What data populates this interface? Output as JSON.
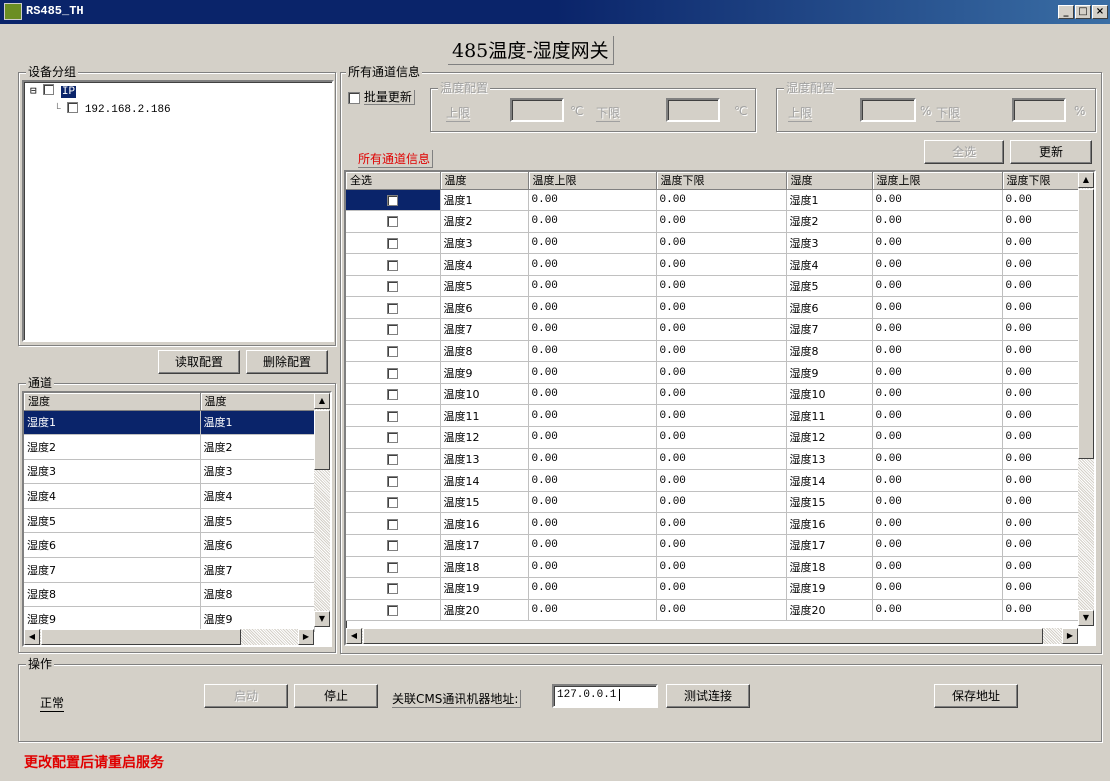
{
  "window": {
    "title": "RS485_TH",
    "min": "_",
    "max": "□",
    "close": "×"
  },
  "header": {
    "title": "485温度-湿度网关"
  },
  "device_group": {
    "label": "设备分组",
    "root": "IP",
    "root_toggle": "⊟",
    "child": "192.168.2.186",
    "read_btn": "读取配置",
    "delete_btn": "删除配置"
  },
  "channel": {
    "label": "通道",
    "headers": [
      "湿度",
      "温度"
    ],
    "rows": [
      [
        "湿度1",
        "温度1"
      ],
      [
        "湿度2",
        "温度2"
      ],
      [
        "湿度3",
        "温度3"
      ],
      [
        "湿度4",
        "温度4"
      ],
      [
        "湿度5",
        "温度5"
      ],
      [
        "湿度6",
        "温度6"
      ],
      [
        "湿度7",
        "温度7"
      ],
      [
        "湿度8",
        "温度8"
      ],
      [
        "湿度9",
        "温度9"
      ]
    ]
  },
  "all_info": {
    "label": "所有通道信息",
    "batch_update": "批量更新",
    "temp_cfg": {
      "label": "温度配置",
      "upper": "上限",
      "lower": "下限",
      "unit": "℃"
    },
    "humid_cfg": {
      "label": "湿度配置",
      "upper": "上限",
      "lower": "下限",
      "unit": "%"
    },
    "sub_label": "所有通道信息",
    "select_all_btn": "全选",
    "update_btn": "更新",
    "headers": [
      "全选",
      "温度",
      "温度上限",
      "温度下限",
      "湿度",
      "湿度上限",
      "湿度下限"
    ],
    "rows": [
      [
        "温度1",
        "0.00",
        "0.00",
        "湿度1",
        "0.00",
        "0.00"
      ],
      [
        "温度2",
        "0.00",
        "0.00",
        "湿度2",
        "0.00",
        "0.00"
      ],
      [
        "温度3",
        "0.00",
        "0.00",
        "湿度3",
        "0.00",
        "0.00"
      ],
      [
        "温度4",
        "0.00",
        "0.00",
        "湿度4",
        "0.00",
        "0.00"
      ],
      [
        "温度5",
        "0.00",
        "0.00",
        "湿度5",
        "0.00",
        "0.00"
      ],
      [
        "温度6",
        "0.00",
        "0.00",
        "湿度6",
        "0.00",
        "0.00"
      ],
      [
        "温度7",
        "0.00",
        "0.00",
        "湿度7",
        "0.00",
        "0.00"
      ],
      [
        "温度8",
        "0.00",
        "0.00",
        "湿度8",
        "0.00",
        "0.00"
      ],
      [
        "温度9",
        "0.00",
        "0.00",
        "湿度9",
        "0.00",
        "0.00"
      ],
      [
        "温度10",
        "0.00",
        "0.00",
        "湿度10",
        "0.00",
        "0.00"
      ],
      [
        "温度11",
        "0.00",
        "0.00",
        "湿度11",
        "0.00",
        "0.00"
      ],
      [
        "温度12",
        "0.00",
        "0.00",
        "湿度12",
        "0.00",
        "0.00"
      ],
      [
        "温度13",
        "0.00",
        "0.00",
        "湿度13",
        "0.00",
        "0.00"
      ],
      [
        "温度14",
        "0.00",
        "0.00",
        "湿度14",
        "0.00",
        "0.00"
      ],
      [
        "温度15",
        "0.00",
        "0.00",
        "湿度15",
        "0.00",
        "0.00"
      ],
      [
        "温度16",
        "0.00",
        "0.00",
        "湿度16",
        "0.00",
        "0.00"
      ],
      [
        "温度17",
        "0.00",
        "0.00",
        "湿度17",
        "0.00",
        "0.00"
      ],
      [
        "温度18",
        "0.00",
        "0.00",
        "湿度18",
        "0.00",
        "0.00"
      ],
      [
        "温度19",
        "0.00",
        "0.00",
        "湿度19",
        "0.00",
        "0.00"
      ],
      [
        "温度20",
        "0.00",
        "0.00",
        "湿度20",
        "0.00",
        "0.00"
      ]
    ]
  },
  "operation": {
    "label": "操作",
    "status": "正常",
    "start_btn": "启动",
    "stop_btn": "停止",
    "cms_label": "关联CMS通讯机器地址:",
    "cms_addr": "127.0.0.1",
    "test_btn": "测试连接",
    "save_btn": "保存地址"
  },
  "footer": {
    "warning": "更改配置后请重启服务"
  },
  "colors": {
    "selection": "#0a246a",
    "warning": "#e00000",
    "face": "#d4d0c8"
  }
}
